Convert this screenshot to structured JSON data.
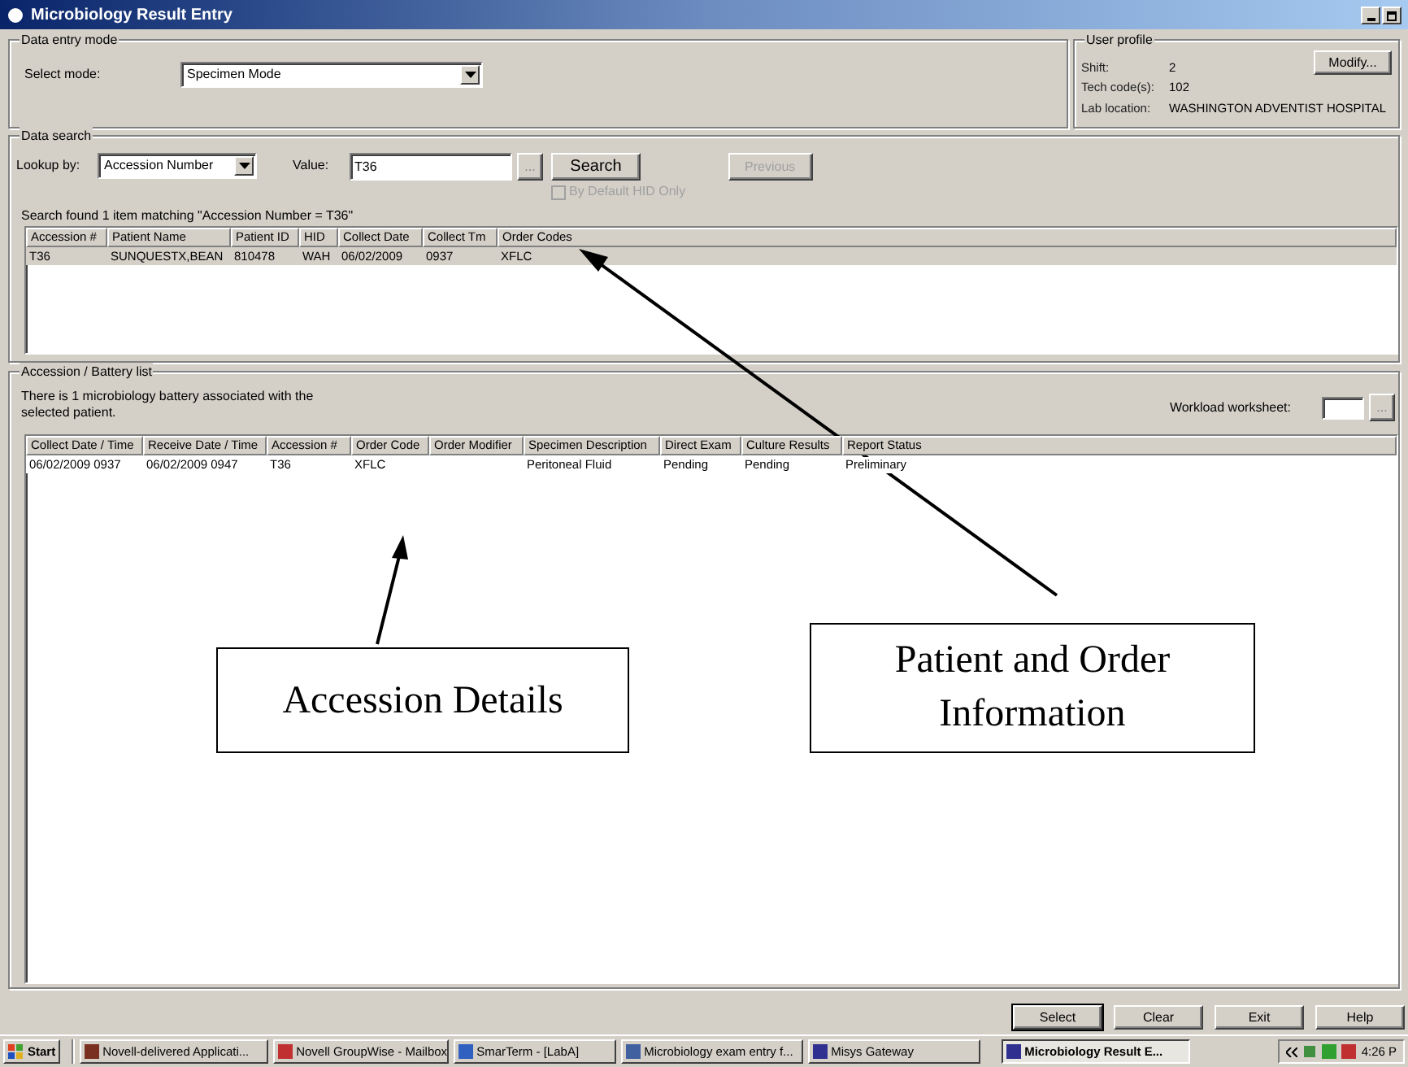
{
  "window": {
    "title": "Microbiology Result Entry"
  },
  "data_entry_mode": {
    "legend": "Data entry mode",
    "select_label": "Select mode:",
    "mode": "Specimen Mode"
  },
  "user_profile": {
    "legend": "User profile",
    "fields": [
      {
        "label": "Shift:",
        "value": "2"
      },
      {
        "label": "Tech code(s):",
        "value": "102"
      },
      {
        "label": "Lab location:",
        "value": "WASHINGTON ADVENTIST HOSPITAL"
      }
    ],
    "modify_button": "Modify..."
  },
  "data_search": {
    "legend": "Data search",
    "lookup_label": "Lookup by:",
    "lookup_value": "Accession Number",
    "value_label": "Value:",
    "value": "T36",
    "browse_button": "...",
    "search_button": "Search",
    "previous_button": {
      "label": "Previous",
      "disabled": true
    },
    "default_hid": {
      "label": "By Default HID Only",
      "checked": false,
      "disabled": true
    },
    "result_message": "Search found 1 item matching \"Accession Number = T36\"",
    "table": {
      "columns": [
        "Accession #",
        "Patient Name",
        "Patient ID",
        "HID",
        "Collect Date",
        "Collect Tm",
        "Order Codes"
      ],
      "rows": [
        {
          "cells": [
            "T36",
            "SUNQUESTX,BEAN",
            "810478",
            "WAH",
            "06/02/2009",
            "0937",
            "XFLC"
          ],
          "selected": true
        }
      ]
    }
  },
  "accession_list": {
    "legend": "Accession / Battery list",
    "message": "There is 1 microbiology battery associated with the selected patient.",
    "workload_label": "Workload worksheet:",
    "browse_button": "...",
    "table": {
      "columns": [
        "Collect Date / Time",
        "Receive Date / Time",
        "Accession #",
        "Order Code",
        "Order Modifier",
        "Specimen Description",
        "Direct Exam",
        "Culture Results",
        "Report Status"
      ],
      "rows": [
        {
          "cells": [
            "06/02/2009 0937",
            "06/02/2009 0947",
            "T36",
            "XFLC",
            "",
            "Peritoneal Fluid",
            "Pending",
            "Pending",
            "Preliminary"
          ],
          "selected": false
        }
      ]
    }
  },
  "buttons": [
    "Select",
    "Clear",
    "Exit",
    "Help"
  ],
  "taskbar": {
    "start": "Start",
    "items": [
      {
        "label": "Novell-delivered Applicati...",
        "selected": false
      },
      {
        "label": "Novell GroupWise - Mailbox",
        "selected": false
      },
      {
        "label": "SmarTerm - [LabA]",
        "selected": false
      },
      {
        "label": "Microbiology exam entry f...",
        "selected": false
      },
      {
        "label": "Misys Gateway",
        "selected": false
      },
      {
        "label": "Microbiology Result E...",
        "selected": true
      }
    ],
    "clock": "4:26 P"
  },
  "annotations": [
    {
      "text": "Accession Details"
    },
    {
      "text": "Patient and Order Information"
    }
  ]
}
